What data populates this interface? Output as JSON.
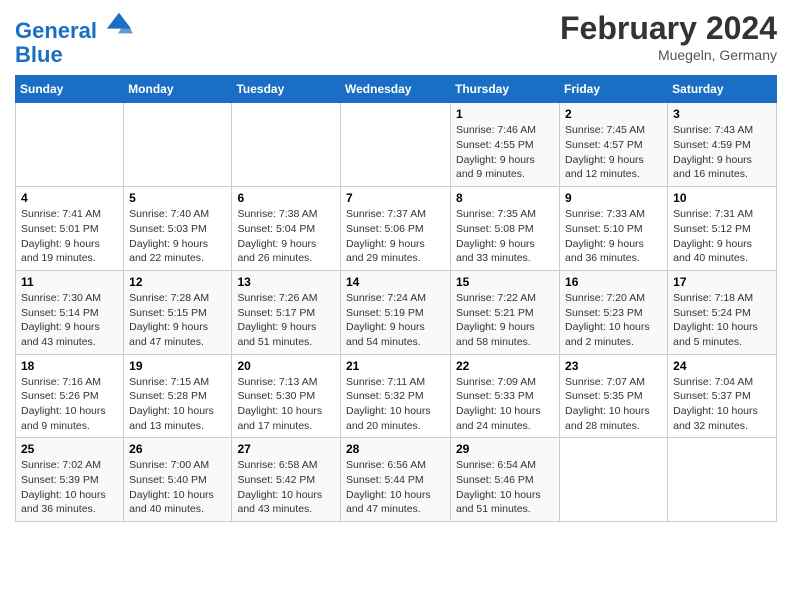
{
  "header": {
    "logo_line1": "General",
    "logo_line2": "Blue",
    "month_title": "February 2024",
    "location": "Muegeln, Germany"
  },
  "days_of_week": [
    "Sunday",
    "Monday",
    "Tuesday",
    "Wednesday",
    "Thursday",
    "Friday",
    "Saturday"
  ],
  "weeks": [
    [
      {
        "day": "",
        "info": ""
      },
      {
        "day": "",
        "info": ""
      },
      {
        "day": "",
        "info": ""
      },
      {
        "day": "",
        "info": ""
      },
      {
        "day": "1",
        "info": "Sunrise: 7:46 AM\nSunset: 4:55 PM\nDaylight: 9 hours\nand 9 minutes."
      },
      {
        "day": "2",
        "info": "Sunrise: 7:45 AM\nSunset: 4:57 PM\nDaylight: 9 hours\nand 12 minutes."
      },
      {
        "day": "3",
        "info": "Sunrise: 7:43 AM\nSunset: 4:59 PM\nDaylight: 9 hours\nand 16 minutes."
      }
    ],
    [
      {
        "day": "4",
        "info": "Sunrise: 7:41 AM\nSunset: 5:01 PM\nDaylight: 9 hours\nand 19 minutes."
      },
      {
        "day": "5",
        "info": "Sunrise: 7:40 AM\nSunset: 5:03 PM\nDaylight: 9 hours\nand 22 minutes."
      },
      {
        "day": "6",
        "info": "Sunrise: 7:38 AM\nSunset: 5:04 PM\nDaylight: 9 hours\nand 26 minutes."
      },
      {
        "day": "7",
        "info": "Sunrise: 7:37 AM\nSunset: 5:06 PM\nDaylight: 9 hours\nand 29 minutes."
      },
      {
        "day": "8",
        "info": "Sunrise: 7:35 AM\nSunset: 5:08 PM\nDaylight: 9 hours\nand 33 minutes."
      },
      {
        "day": "9",
        "info": "Sunrise: 7:33 AM\nSunset: 5:10 PM\nDaylight: 9 hours\nand 36 minutes."
      },
      {
        "day": "10",
        "info": "Sunrise: 7:31 AM\nSunset: 5:12 PM\nDaylight: 9 hours\nand 40 minutes."
      }
    ],
    [
      {
        "day": "11",
        "info": "Sunrise: 7:30 AM\nSunset: 5:14 PM\nDaylight: 9 hours\nand 43 minutes."
      },
      {
        "day": "12",
        "info": "Sunrise: 7:28 AM\nSunset: 5:15 PM\nDaylight: 9 hours\nand 47 minutes."
      },
      {
        "day": "13",
        "info": "Sunrise: 7:26 AM\nSunset: 5:17 PM\nDaylight: 9 hours\nand 51 minutes."
      },
      {
        "day": "14",
        "info": "Sunrise: 7:24 AM\nSunset: 5:19 PM\nDaylight: 9 hours\nand 54 minutes."
      },
      {
        "day": "15",
        "info": "Sunrise: 7:22 AM\nSunset: 5:21 PM\nDaylight: 9 hours\nand 58 minutes."
      },
      {
        "day": "16",
        "info": "Sunrise: 7:20 AM\nSunset: 5:23 PM\nDaylight: 10 hours\nand 2 minutes."
      },
      {
        "day": "17",
        "info": "Sunrise: 7:18 AM\nSunset: 5:24 PM\nDaylight: 10 hours\nand 5 minutes."
      }
    ],
    [
      {
        "day": "18",
        "info": "Sunrise: 7:16 AM\nSunset: 5:26 PM\nDaylight: 10 hours\nand 9 minutes."
      },
      {
        "day": "19",
        "info": "Sunrise: 7:15 AM\nSunset: 5:28 PM\nDaylight: 10 hours\nand 13 minutes."
      },
      {
        "day": "20",
        "info": "Sunrise: 7:13 AM\nSunset: 5:30 PM\nDaylight: 10 hours\nand 17 minutes."
      },
      {
        "day": "21",
        "info": "Sunrise: 7:11 AM\nSunset: 5:32 PM\nDaylight: 10 hours\nand 20 minutes."
      },
      {
        "day": "22",
        "info": "Sunrise: 7:09 AM\nSunset: 5:33 PM\nDaylight: 10 hours\nand 24 minutes."
      },
      {
        "day": "23",
        "info": "Sunrise: 7:07 AM\nSunset: 5:35 PM\nDaylight: 10 hours\nand 28 minutes."
      },
      {
        "day": "24",
        "info": "Sunrise: 7:04 AM\nSunset: 5:37 PM\nDaylight: 10 hours\nand 32 minutes."
      }
    ],
    [
      {
        "day": "25",
        "info": "Sunrise: 7:02 AM\nSunset: 5:39 PM\nDaylight: 10 hours\nand 36 minutes."
      },
      {
        "day": "26",
        "info": "Sunrise: 7:00 AM\nSunset: 5:40 PM\nDaylight: 10 hours\nand 40 minutes."
      },
      {
        "day": "27",
        "info": "Sunrise: 6:58 AM\nSunset: 5:42 PM\nDaylight: 10 hours\nand 43 minutes."
      },
      {
        "day": "28",
        "info": "Sunrise: 6:56 AM\nSunset: 5:44 PM\nDaylight: 10 hours\nand 47 minutes."
      },
      {
        "day": "29",
        "info": "Sunrise: 6:54 AM\nSunset: 5:46 PM\nDaylight: 10 hours\nand 51 minutes."
      },
      {
        "day": "",
        "info": ""
      },
      {
        "day": "",
        "info": ""
      }
    ]
  ]
}
